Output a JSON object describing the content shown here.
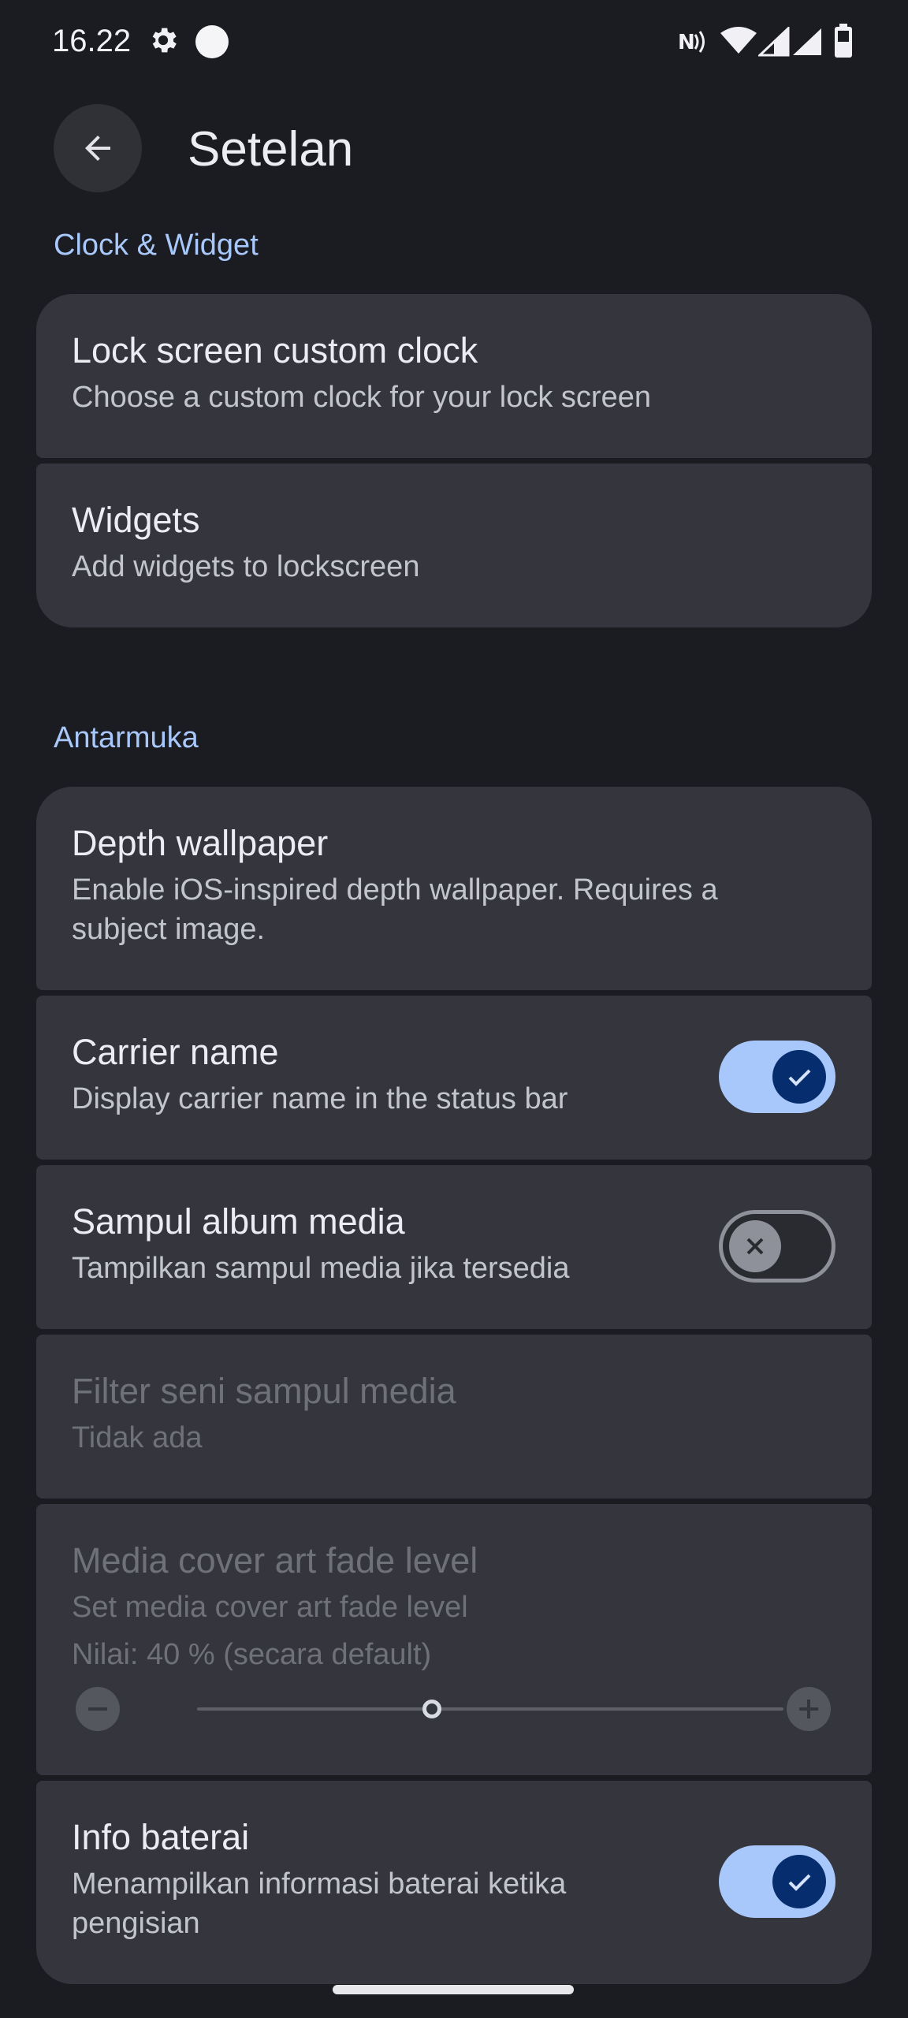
{
  "status_bar": {
    "time": "16.22",
    "icons": [
      "settings-gear-icon",
      "circle-notification-icon",
      "nfc-icon",
      "wifi-icon",
      "signal-icon",
      "signal-icon",
      "battery-icon"
    ]
  },
  "app_bar": {
    "title": "Setelan",
    "back_icon": "arrow-back-icon"
  },
  "sections": {
    "clock_widget": {
      "label": "Clock & Widget",
      "items": [
        {
          "title": "Lock screen custom clock",
          "subtitle": "Choose a custom clock for your lock screen"
        },
        {
          "title": "Widgets",
          "subtitle": "Add widgets to lockscreen"
        }
      ]
    },
    "interface": {
      "label": "Antarmuka",
      "items": [
        {
          "title": "Depth wallpaper",
          "subtitle": "Enable iOS-inspired depth wallpaper. Requires a subject image."
        },
        {
          "title": "Carrier name",
          "subtitle": "Display carrier name in the status bar",
          "toggle": true
        },
        {
          "title": "Sampul album media",
          "subtitle": "Tampilkan sampul media jika tersedia",
          "toggle": false
        },
        {
          "title": "Filter seni sampul media",
          "subtitle": "Tidak ada",
          "enabled": false
        },
        {
          "title": "Media cover art fade level",
          "subtitle": "Set media cover art fade level",
          "value_text": "Nilai: 40 % (secara default)",
          "slider_value_percent": 40,
          "enabled": false
        },
        {
          "title": "Info baterai",
          "subtitle": "Menampilkan informasi baterai ketika pengisian",
          "toggle": true
        }
      ]
    }
  },
  "colors": {
    "background": "#1b1c21",
    "card": "#35363d",
    "accent": "#a8c7fa",
    "toggle_knob_on": "#062e6f"
  }
}
